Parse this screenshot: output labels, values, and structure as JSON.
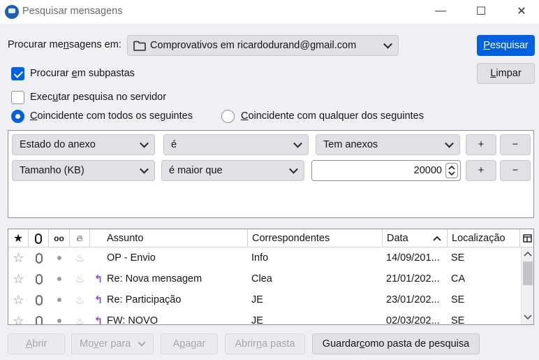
{
  "window": {
    "title": "Pesquisar mensagens",
    "minimize": "—",
    "maximize": "☐",
    "close": "✕"
  },
  "search": {
    "folder_label_pre": "Procurar me",
    "folder_label_u": "n",
    "folder_label_post": "sagens em:",
    "folder_value": "Comprovativos em ricardodurand@gmail.com",
    "search_button_u": "P",
    "search_button_rest": "esquisar",
    "clear_button_u": "L",
    "clear_button_rest": "impar",
    "subfolders_pre": "Procurar ",
    "subfolders_u": "e",
    "subfolders_post": "m subpastas",
    "subfolders_checked": true,
    "server_pre": "Exec",
    "server_u": "u",
    "server_post": "tar pesquisa no servidor",
    "server_checked": false,
    "match_all_u": "C",
    "match_all_rest": "oincidente com todos os seguintes",
    "match_any_u": "C",
    "match_any_rest": "oincidente com qualquer dos seguintes",
    "match_mode": "all"
  },
  "rules": [
    {
      "field": "Estado do anexo",
      "operator": "é",
      "value": "Tem anexos",
      "add": "+",
      "remove": "−"
    },
    {
      "field": "Tamanho (KB)",
      "operator": "é maior que",
      "value": "20000",
      "add": "+",
      "remove": "−"
    }
  ],
  "results": {
    "columns": {
      "subject": "Assunto",
      "correspondents": "Correspondentes",
      "date": "Data",
      "location": "Localização"
    },
    "sort": {
      "column": "Data",
      "direction": "ascending"
    },
    "rows": [
      {
        "replied": false,
        "subject": "OP - Envio",
        "correspondent": "Info",
        "date": "14/09/201...",
        "location": "SE"
      },
      {
        "replied": true,
        "subject": "Re: Nova mensagem",
        "correspondent": "Clea",
        "date": "21/01/202...",
        "location": "CA"
      },
      {
        "replied": true,
        "subject": "Re: Participação",
        "correspondent": "JE",
        "date": "23/01/202...",
        "location": "SE"
      },
      {
        "replied": true,
        "subject": "FW: NOVO",
        "correspondent": "JE",
        "date": "02/03/202...",
        "location": "SE"
      }
    ]
  },
  "footer": {
    "open_u": "A",
    "open_rest": "brir",
    "move_pre": "Mo",
    "move_u": "v",
    "move_post": "er para",
    "delete_pre": "A",
    "delete_u": "p",
    "delete_post": "agar",
    "open_folder_pre": "Abrir ",
    "open_folder_u": "n",
    "open_folder_post": "a pasta",
    "save_pre": "Guardar ",
    "save_u": "c",
    "save_post": "omo pasta de pesquisa"
  },
  "colors": {
    "accent": "#0061e0",
    "reply_icon": "#8a4bdb"
  },
  "icons": {
    "app": "thunderbird-icon",
    "folder": "folder-icon",
    "star": "star-icon",
    "attachment": "attachment-icon",
    "thread": "thread-icon",
    "junk": "flame-icon",
    "reply": "reply-icon",
    "column_picker": "column-picker-icon"
  }
}
